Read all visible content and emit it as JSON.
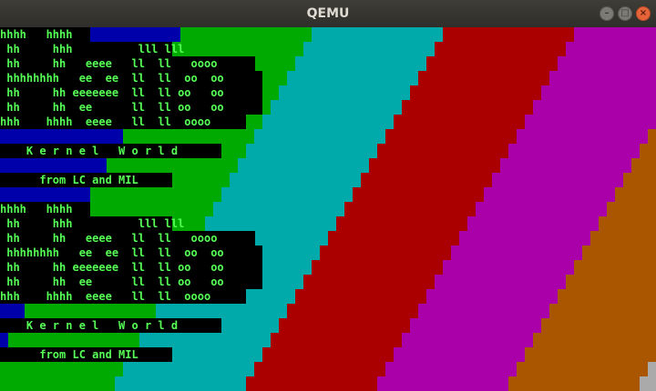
{
  "window": {
    "title": "QEMU",
    "buttons": {
      "minimize": "–",
      "maximize": "□",
      "close": "×"
    }
  },
  "screen": {
    "colors": {
      "text_fg": "#55ff55",
      "text_bg": "#000000",
      "blue": "#0000aa",
      "green": "#00aa00",
      "cyan": "#00aaaa",
      "red": "#aa0000",
      "magenta": "#aa00aa",
      "brown": "#aa5500",
      "light_gray": "#aaaaaa"
    },
    "lines": [
      "hhhh   hhhh",
      " hh     hhh          lll lll",
      " hh     hh   eeee   ll  ll   oooo",
      " hhhhhhhh   ee  ee  ll  ll  oo  oo",
      " hh     hh eeeeeee  ll  ll oo   oo",
      " hh     hh  ee      ll  ll oo   oo",
      "hhh    hhhh  eeee   ll  ll  oooo",
      "",
      "    K e r n e l   W o r l d",
      "",
      "      from LC and MIL",
      "",
      "hhhh   hhhh",
      " hh     hhh          lll lll",
      " hh     hh   eeee   ll  ll   oooo",
      " hhhhhhhh   ee  ee  ll  ll  oo  oo",
      " hh     hh eeeeeee  ll  ll oo   oo",
      " hh     hh  ee      ll  ll oo   oo",
      "hhh    hhhh  eeee   ll  ll  oooo",
      "",
      "    K e r n e l   W o r l d",
      "",
      "      from LC and MIL",
      ""
    ]
  }
}
